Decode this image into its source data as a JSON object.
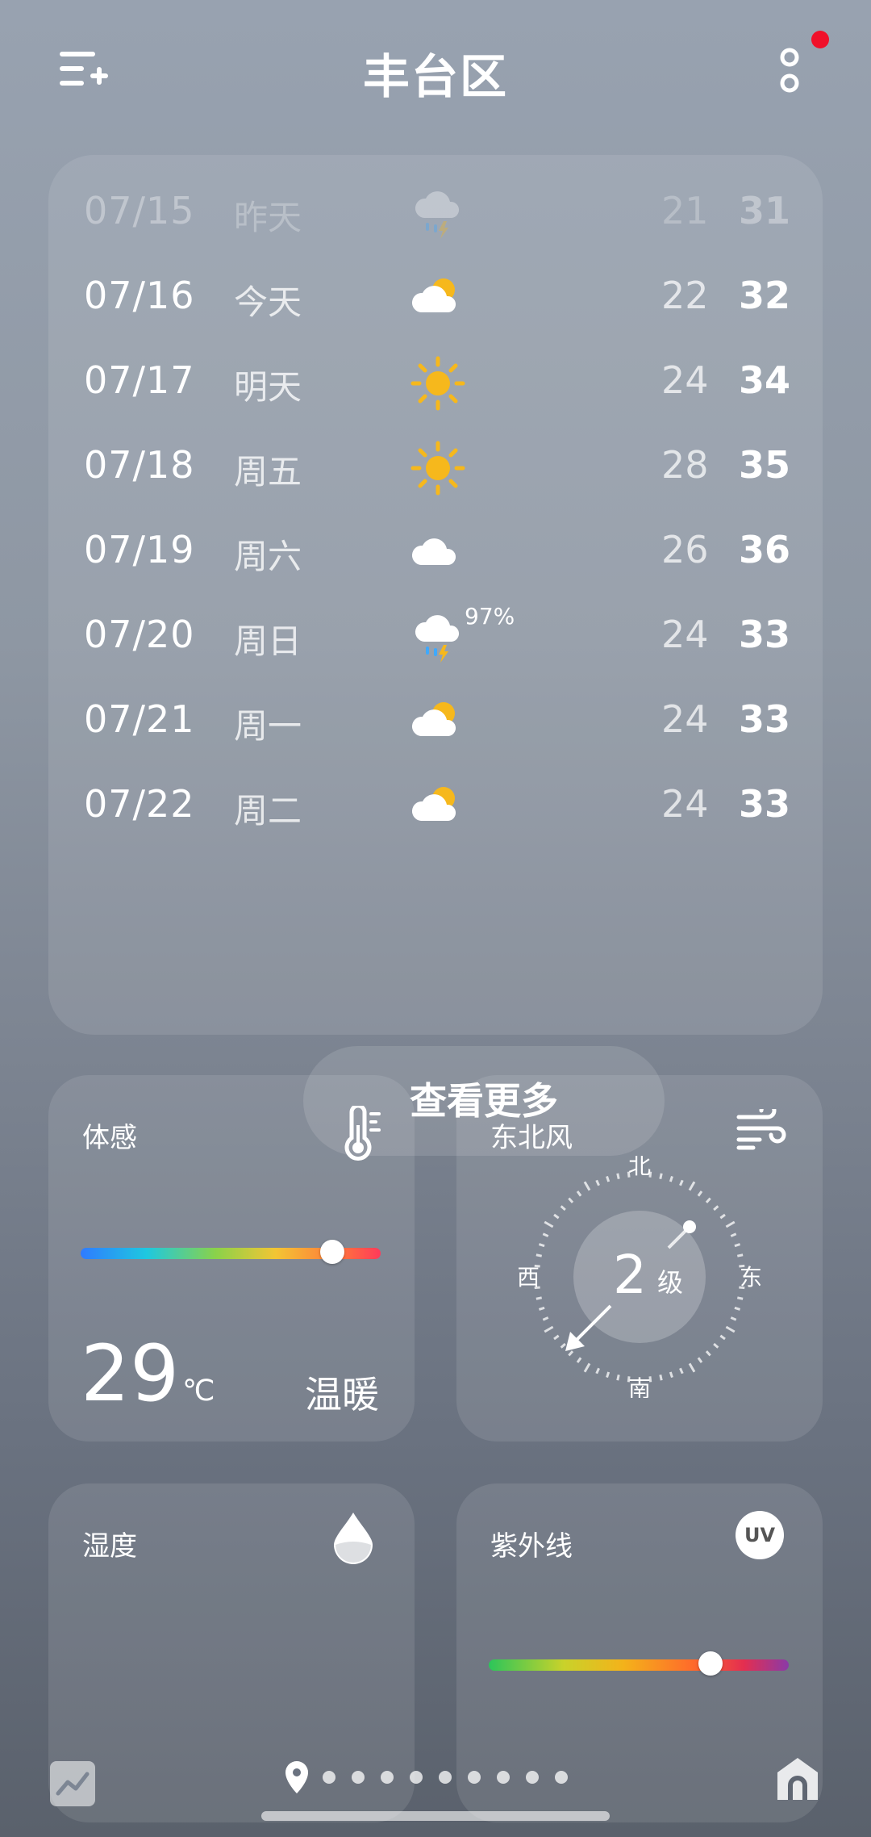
{
  "header": {
    "title": "丰台区"
  },
  "forecast": [
    {
      "date": "07/15",
      "day": "昨天",
      "icon": "thunder-rain-icon",
      "pct": "",
      "low": "21",
      "high": "31",
      "past": true
    },
    {
      "date": "07/16",
      "day": "今天",
      "icon": "partly-cloudy-icon",
      "pct": "",
      "low": "22",
      "high": "32",
      "past": false
    },
    {
      "date": "07/17",
      "day": "明天",
      "icon": "sun-icon",
      "pct": "",
      "low": "24",
      "high": "34",
      "past": false
    },
    {
      "date": "07/18",
      "day": "周五",
      "icon": "sun-icon",
      "pct": "",
      "low": "28",
      "high": "35",
      "past": false
    },
    {
      "date": "07/19",
      "day": "周六",
      "icon": "cloud-icon",
      "pct": "",
      "low": "26",
      "high": "36",
      "past": false
    },
    {
      "date": "07/20",
      "day": "周日",
      "icon": "thunder-rain-icon",
      "pct": "97%",
      "low": "24",
      "high": "33",
      "past": false
    },
    {
      "date": "07/21",
      "day": "周一",
      "icon": "partly-cloudy-icon",
      "pct": "",
      "low": "24",
      "high": "33",
      "past": false
    },
    {
      "date": "07/22",
      "day": "周二",
      "icon": "partly-cloudy-icon",
      "pct": "",
      "low": "24",
      "high": "33",
      "past": false
    }
  ],
  "more_label": "查看更多",
  "feel": {
    "title": "体感",
    "value": "29",
    "unit": "℃",
    "desc": "温暖",
    "level": 0.84
  },
  "wind": {
    "title": "东北风",
    "level_num": "2",
    "level_unit": "级",
    "north": "北",
    "south": "南",
    "east": "东",
    "west": "西"
  },
  "humidity": {
    "title": "湿度"
  },
  "uv": {
    "title": "紫外线",
    "badge": "UV",
    "level": 0.74
  },
  "colors": {
    "sun": "#f6b81c",
    "notification": "#f0102a"
  },
  "pages": {
    "count": 9
  }
}
